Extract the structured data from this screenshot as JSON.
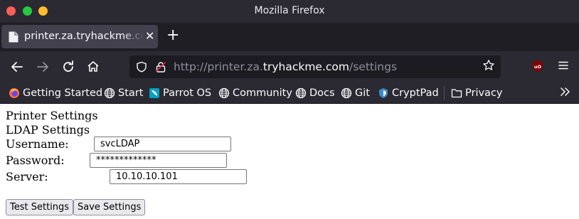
{
  "window": {
    "title": "Mozilla Firefox"
  },
  "tab": {
    "title": "printer.za.tryhackme.com/settings",
    "close": "✕",
    "new_tab": "+"
  },
  "urlbar": {
    "scheme": "http://",
    "sub": "printer.za.",
    "host": "tryhackme.com",
    "path": "/settings"
  },
  "bookmarks": [
    {
      "label": "Getting Started",
      "icon": "firefox-icon"
    },
    {
      "label": "Start",
      "icon": "globe-icon"
    },
    {
      "label": "Parrot OS",
      "icon": "parrot-icon"
    },
    {
      "label": "Community",
      "icon": "globe-icon"
    },
    {
      "label": "Docs",
      "icon": "globe-icon"
    },
    {
      "label": "Git",
      "icon": "globe-icon"
    },
    {
      "label": "CryptPad",
      "icon": "cryptpad-icon"
    },
    {
      "label": "Privacy",
      "icon": "folder-icon"
    }
  ],
  "page": {
    "heading": "Printer Settings",
    "subheading": "LDAP Settings",
    "username_label": "Username:",
    "username_value": "svcLDAP",
    "password_label": "Password:",
    "password_value": "*************",
    "server_label": "Server:",
    "server_value": "10.10.10.101",
    "test_button": "Test Settings",
    "save_button": "Save Settings"
  },
  "colors": {
    "chrome_bg": "#2b2a33",
    "tab_active": "#42414d",
    "urlbar_bg": "#1c1b22",
    "close": "#ff5f57",
    "minimize": "#28c840",
    "maximize": "#ffbd2e"
  }
}
